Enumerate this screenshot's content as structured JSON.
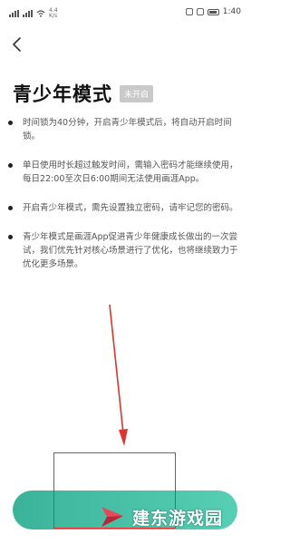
{
  "status_bar": {
    "network_speed": "4.4\nK/s",
    "time": "1:40"
  },
  "page": {
    "title": "青少年模式",
    "status_badge": "未开启"
  },
  "items": [
    {
      "text": "时间锁为40分钟，开启青少年模式后，将自动开启时间锁。"
    },
    {
      "text": "单日使用时长超过触发时间，需输入密码才能继续使用，每日22:00至次日6:00期间无法使用画涯App。"
    },
    {
      "text": "开启青少年模式，需先设置独立密码，请牢记您的密码。"
    },
    {
      "text": "青少年模式是画涯App促进青少年健康成长做出的一次尝试，我们优先针对核心场景进行了优化，也将继续致力于优化更多场景。"
    }
  ],
  "watermark": {
    "text": "建东游戏园"
  },
  "colors": {
    "accent": "#45c1a6",
    "annotation": "#e0322f",
    "badge": "#c9c9c9"
  }
}
